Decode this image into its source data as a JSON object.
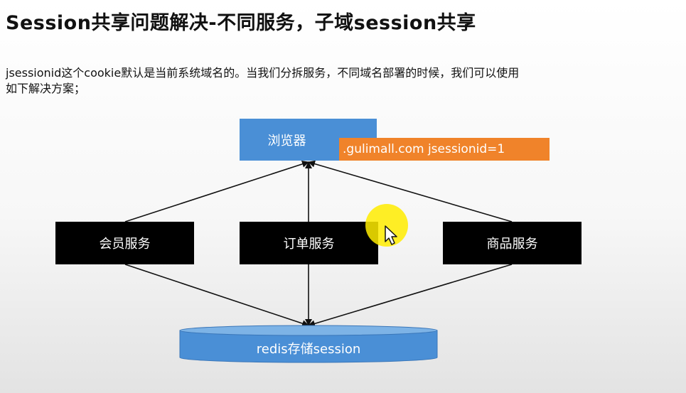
{
  "slide": {
    "title": "Session共享问题解决-不同服务，子域session共享",
    "body_lines": [
      "jsessionid这个cookie默认是当前系统域名的。当我们分拆服务，不同域名部署的时候，我们可以使用",
      "如下解决方案；"
    ]
  },
  "diagram": {
    "browser": "浏览器",
    "cookie": ".gulimall.com  jsessionid=1",
    "services": [
      "会员服务",
      "订单服务",
      "商品服务"
    ],
    "store": "redis存储session"
  },
  "colors": {
    "browser_fill": "#4a8fd6",
    "service_fill": "#000000",
    "cookie_fill": "#f0832a",
    "store_fill": "#4a8fd6",
    "store_top": "#7db3e6",
    "cursor_highlight": "#ffec00"
  },
  "icons": {
    "cursor": "mouse-pointer-icon"
  }
}
